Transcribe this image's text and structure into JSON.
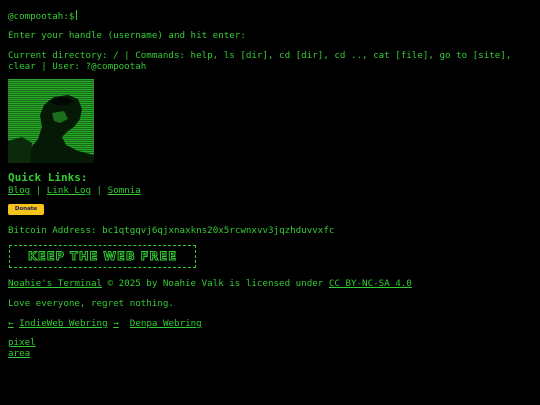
{
  "prompt": {
    "text": "@compootah:$"
  },
  "instructions": "Enter your handle (username) and hit enter:",
  "status": {
    "line": "Current directory: / | Commands: help, ls [dir], cd [dir], cd .., cat [file], go to [site], clear | User: ?@compootah"
  },
  "quick_links": {
    "title": "Quick Links:",
    "links": [
      "Blog",
      "Link Log",
      "Somnia"
    ],
    "separator": " | "
  },
  "donate": {
    "label": "Donate"
  },
  "bitcoin": {
    "label": "Bitcoin Address:",
    "address": "bc1qtgqvj6qjxnaxkns20x5rcwnxvv3jqzhduvvxfc"
  },
  "banner": {
    "text": "KEEP THE WEB FREE"
  },
  "license": {
    "site_name": "Noahie's Terminal",
    "middle": " © 2025 by Noahie Valk is licensed under ",
    "license_link": "CC BY-NC-SA 4.0"
  },
  "tagline": "Love everyone, regret nothing.",
  "webrings": {
    "indieweb": {
      "prev": "←",
      "name": "IndieWeb Webring",
      "next": "→"
    },
    "denpa": "Denpa Webring"
  },
  "pixel_area": {
    "alt": "pixel area"
  },
  "colors": {
    "background": "#000000",
    "text": "#33cc33",
    "donate_bg": "#f7c21a"
  }
}
